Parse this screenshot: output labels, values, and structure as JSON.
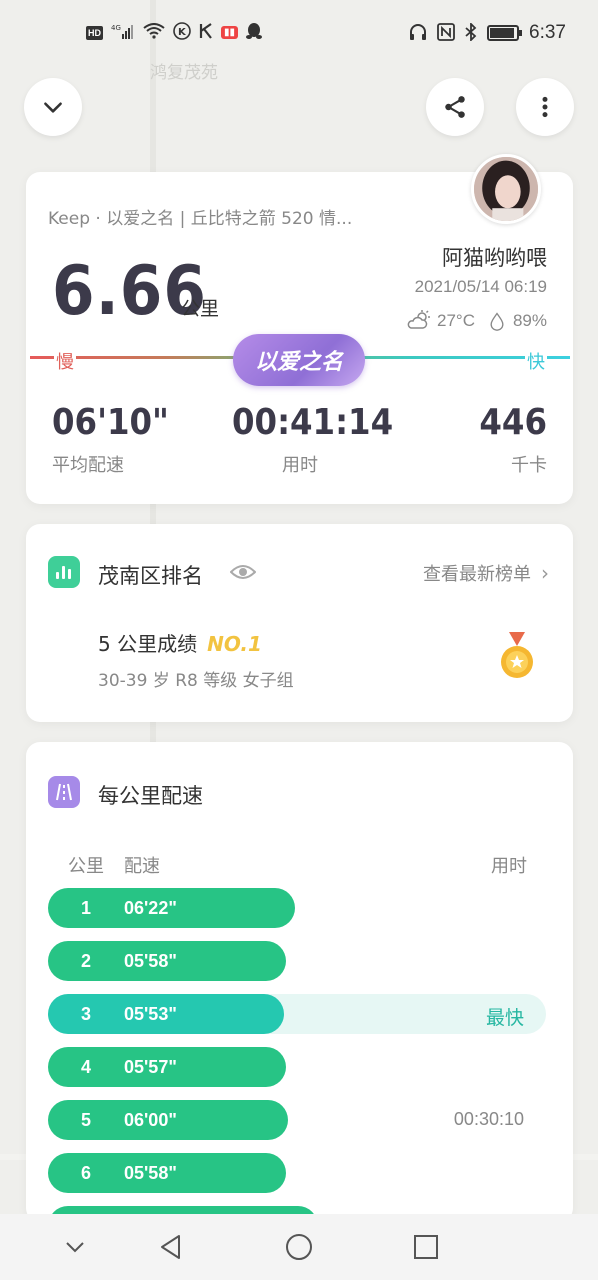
{
  "status_bar": {
    "time": "6:37",
    "network": "4G",
    "hd": "HD"
  },
  "map": {
    "label": "鸿复茂苑"
  },
  "summary": {
    "route_title": "Keep · 以爱之名 | 丘比特之箭 520 情...",
    "user_name": "阿猫哟哟喂",
    "date": "2021/05/14 06:19",
    "temperature": "27°C",
    "humidity": "89%",
    "distance": "6.66",
    "distance_unit": "公里",
    "slow_label": "慢",
    "fast_label": "快",
    "theme_badge": "以爱之名",
    "stats": [
      {
        "value": "06'10\"",
        "label": "平均配速"
      },
      {
        "value": "00:41:14",
        "label": "用时"
      },
      {
        "value": "446",
        "label": "千卡"
      }
    ]
  },
  "ranking": {
    "title": "茂南区排名",
    "link": "查看最新榜单",
    "result": "5 公里成绩",
    "rank": "NO.1",
    "group": "30-39 岁 R8 等级 女子组"
  },
  "splits": {
    "title": "每公里配速",
    "headers": {
      "km": "公里",
      "pace": "配速",
      "time": "用时"
    },
    "rows": [
      {
        "km": "1",
        "pace": "06'22\"",
        "share": 0.495,
        "note": ""
      },
      {
        "km": "2",
        "pace": "05'58\"",
        "share": 0.478,
        "note": ""
      },
      {
        "km": "3",
        "pace": "05'53\"",
        "share": 0.474,
        "note": "最快",
        "fastest": true
      },
      {
        "km": "4",
        "pace": "05'57\"",
        "share": 0.478,
        "note": ""
      },
      {
        "km": "5",
        "pace": "06'00\"",
        "share": 0.481,
        "note": "00:30:10"
      },
      {
        "km": "6",
        "pace": "05'58\"",
        "share": 0.478,
        "note": ""
      }
    ]
  },
  "colors": {
    "green": "#27c485",
    "teal": "#25c8b0",
    "purple": "#9b76e0",
    "gold": "#f2c340"
  }
}
